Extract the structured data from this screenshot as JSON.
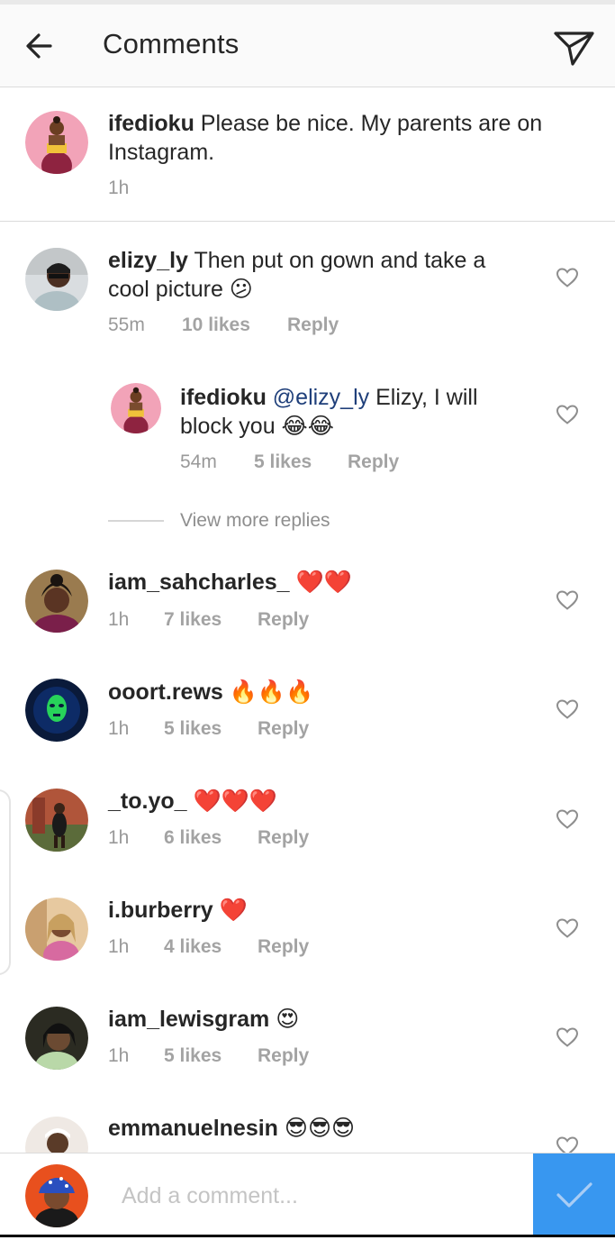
{
  "header": {
    "title": "Comments",
    "back_icon": "arrow-left-icon",
    "share_icon": "paper-plane-icon"
  },
  "caption": {
    "username": "ifedioku",
    "text": " Please be nice. My parents are on Instagram.",
    "time": "1h"
  },
  "comments": [
    {
      "username": "elizy_ly",
      "text": " Then put on  gown and take a cool picture 😕",
      "time": "55m",
      "likes": "10 likes",
      "reply": "Reply"
    },
    {
      "username": "ifedioku",
      "mention": " @elizy_ly",
      "text": " Elizy, I will block you 😂😂",
      "time": "54m",
      "likes": "5 likes",
      "reply": "Reply"
    },
    {
      "username": "iam_sahcharles_",
      "text": " ❤️❤️",
      "time": "1h",
      "likes": "7 likes",
      "reply": "Reply"
    },
    {
      "username": "ooort.rews",
      "text": " 🔥🔥🔥",
      "time": "1h",
      "likes": "5 likes",
      "reply": "Reply"
    },
    {
      "username": "_to.yo_",
      "text": " ❤️❤️❤️",
      "time": "1h",
      "likes": "6 likes",
      "reply": "Reply"
    },
    {
      "username": "i.burberry",
      "text": " ❤️",
      "time": "1h",
      "likes": "4 likes",
      "reply": "Reply"
    },
    {
      "username": "iam_lewisgram",
      "text": " 😍",
      "time": "1h",
      "likes": "5 likes",
      "reply": "Reply"
    },
    {
      "username": "emmanuelnesin",
      "text": " 😎😎😎"
    }
  ],
  "view_more_replies": "View more replies",
  "composer": {
    "placeholder": "Add a comment..."
  },
  "colors": {
    "accent": "#3897f0",
    "mention": "#1f3f7a",
    "meta": "#999999",
    "text": "#262626"
  }
}
